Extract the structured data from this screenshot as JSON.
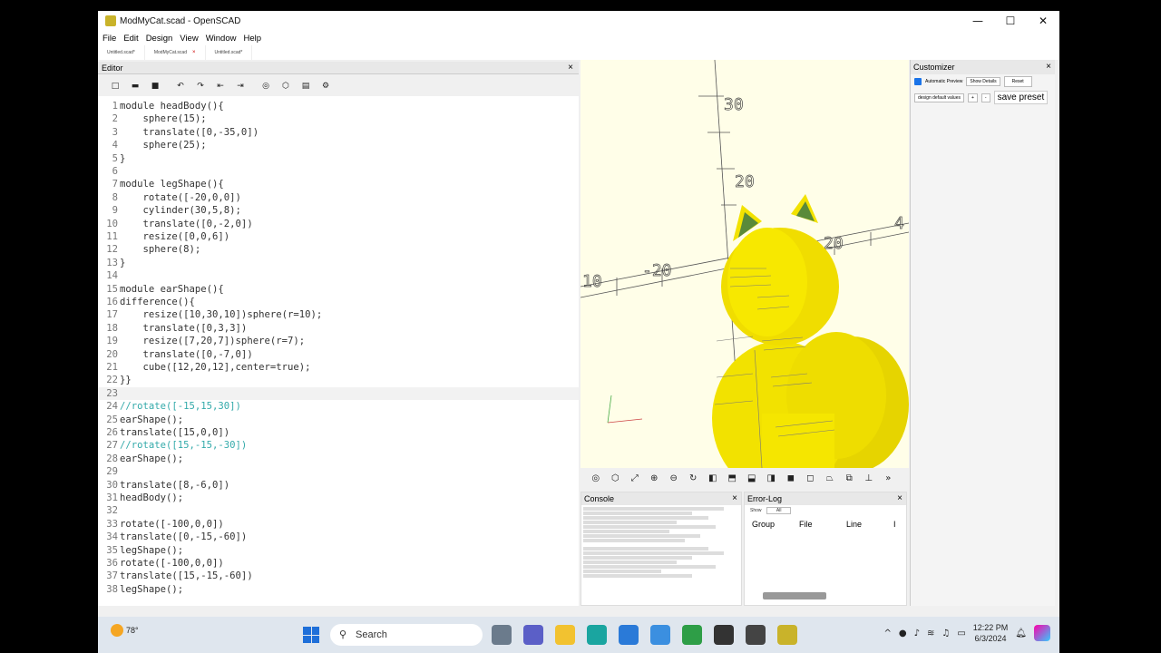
{
  "window": {
    "title": "ModMyCat.scad - OpenSCAD",
    "minimize": "—",
    "maximize": "☐",
    "close": "✕"
  },
  "menu": [
    "File",
    "Edit",
    "Design",
    "View",
    "Window",
    "Help"
  ],
  "tabs": [
    {
      "label": "Untitled.scad*"
    },
    {
      "label": "ModMyCat.scad",
      "close": "×"
    },
    {
      "label": "Untitled.scad*"
    }
  ],
  "editor": {
    "title": "Editor",
    "close": "×",
    "code": [
      {
        "n": "1",
        "text": "module headBody(){"
      },
      {
        "n": "2",
        "text": "    sphere(15);"
      },
      {
        "n": "3",
        "text": "    translate([0,-35,0])"
      },
      {
        "n": "4",
        "text": "    sphere(25);"
      },
      {
        "n": "5",
        "text": "}"
      },
      {
        "n": "6",
        "text": ""
      },
      {
        "n": "7",
        "text": "module legShape(){"
      },
      {
        "n": "8",
        "text": "    rotate([-20,0,0])"
      },
      {
        "n": "9",
        "text": "    cylinder(30,5,8);"
      },
      {
        "n": "10",
        "text": "    translate([0,-2,0])"
      },
      {
        "n": "11",
        "text": "    resize([0,0,6])"
      },
      {
        "n": "12",
        "text": "    sphere(8);"
      },
      {
        "n": "13",
        "text": "}"
      },
      {
        "n": "14",
        "text": ""
      },
      {
        "n": "15",
        "text": "module earShape(){"
      },
      {
        "n": "16",
        "text": "difference(){"
      },
      {
        "n": "17",
        "text": "    resize([10,30,10])sphere(r=10);"
      },
      {
        "n": "18",
        "text": "    translate([0,3,3])"
      },
      {
        "n": "19",
        "text": "    resize([7,20,7])sphere(r=7);"
      },
      {
        "n": "20",
        "text": "    translate([0,-7,0])"
      },
      {
        "n": "21",
        "text": "    cube([12,20,12],center=true);"
      },
      {
        "n": "22",
        "text": "}}"
      },
      {
        "n": "23",
        "text": ""
      },
      {
        "n": "24",
        "text": "//rotate([-15,15,30])"
      },
      {
        "n": "25",
        "text": "earShape();"
      },
      {
        "n": "26",
        "text": "translate([15,0,0])"
      },
      {
        "n": "27",
        "text": "//rotate([15,-15,-30])"
      },
      {
        "n": "28",
        "text": "earShape();"
      },
      {
        "n": "29",
        "text": ""
      },
      {
        "n": "30",
        "text": "translate([8,-6,0])"
      },
      {
        "n": "31",
        "text": "headBody();"
      },
      {
        "n": "32",
        "text": ""
      },
      {
        "n": "33",
        "text": "rotate([-100,0,0])"
      },
      {
        "n": "34",
        "text": "translate([0,-15,-60])"
      },
      {
        "n": "35",
        "text": "legShape();"
      },
      {
        "n": "36",
        "text": "rotate([-100,0,0])"
      },
      {
        "n": "37",
        "text": "translate([15,-15,-60])"
      },
      {
        "n": "38",
        "text": "legShape();"
      }
    ]
  },
  "viewport": {
    "axis_labels": [
      "30",
      "20",
      "10",
      "-20",
      "20",
      "4"
    ]
  },
  "console": {
    "title": "Console",
    "close": "×"
  },
  "error_log": {
    "title": "Error-Log",
    "close": "×",
    "show_label": "Show",
    "show_value": "All",
    "columns": [
      "Group",
      "File",
      "Line",
      "I"
    ]
  },
  "customizer": {
    "title": "Customizer",
    "close": "×",
    "auto_preview": "Automatic Preview",
    "detail_select": "Show Details",
    "reset": "Reset",
    "preset_select": "design default values",
    "plus": "+",
    "minus": "-",
    "save_preset": "save preset"
  },
  "taskbar": {
    "temperature": "78°",
    "search_placeholder": "Search",
    "time": "12:22 PM",
    "date": "6/3/2024"
  },
  "colors": {
    "viewport_bg": "#fffee8",
    "model_yellow": "#f2e200",
    "ear_inner": "#5a8a3a",
    "comment": "#3aa",
    "windows_blue": "#1e6fd9"
  }
}
